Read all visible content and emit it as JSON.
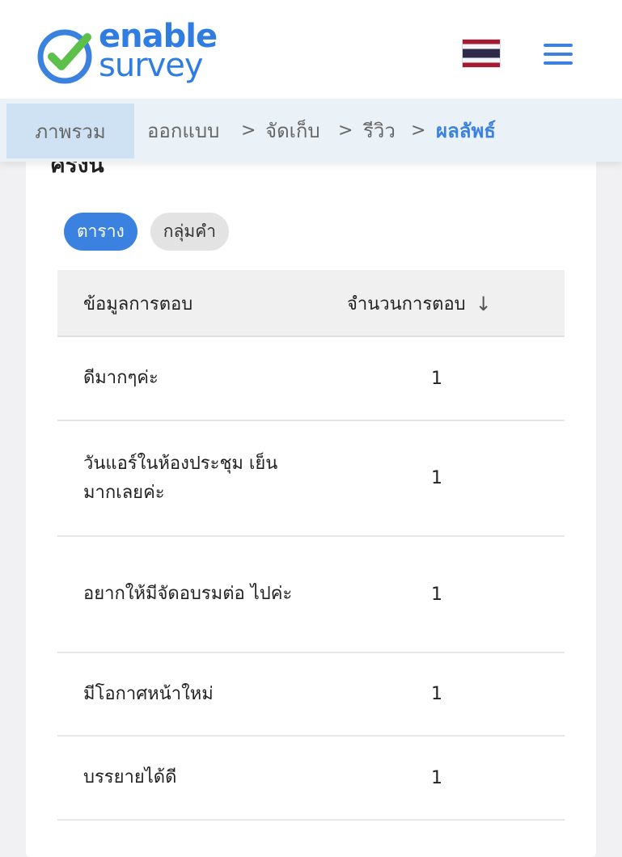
{
  "header": {
    "logo_line1": "enable",
    "logo_line2": "survey",
    "flag_icon": "thailand-flag-icon",
    "menu_icon": "hamburger-menu-icon"
  },
  "breadcrumb": {
    "items": [
      "ภาพรวม",
      "ออกแบบ",
      "จัดเก็บ",
      "รีวิว",
      "ผลลัพธ์"
    ],
    "separator": ">"
  },
  "section": {
    "title": "ครั้งนี้"
  },
  "tabs": [
    "ตาราง",
    "กลุ่มคำ"
  ],
  "table": {
    "columns": [
      "ข้อมูลการตอบ",
      "จำนวนการตอบ"
    ],
    "sort_icon": "↓",
    "rows": [
      {
        "text": "ดีมากๆค่ะ",
        "count": "1"
      },
      {
        "text": "วันแอร์ในห้องประชุม เย็นมากเลยค่ะ",
        "count": "1"
      },
      {
        "text": "อยากให้มีจัดอบรมต่อ ไปค่ะ",
        "count": "1"
      },
      {
        "text": "มีโอกาศหน้าใหม่",
        "count": "1"
      },
      {
        "text": "บรรยายได้ดี",
        "count": "1"
      }
    ]
  },
  "colors": {
    "accent": "#3b82e0",
    "logo_green": "#5cc04a",
    "breadcrumb_bg": "#eaf2f7",
    "active_crumb_bg": "#cfe2f3"
  }
}
